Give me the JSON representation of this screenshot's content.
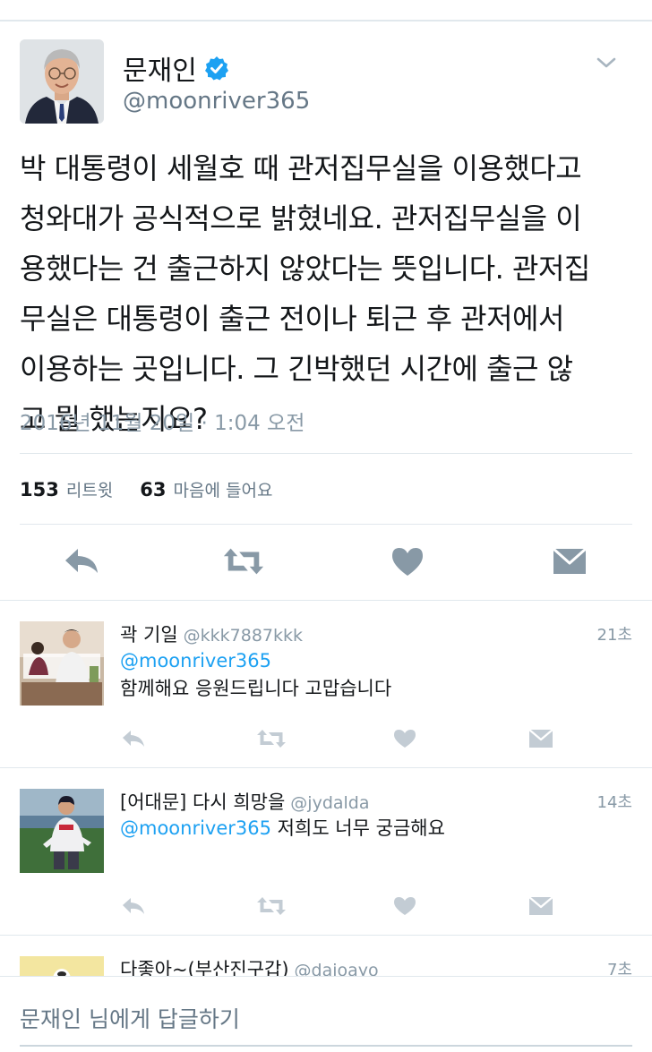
{
  "tweet": {
    "author_name": "문재인",
    "author_handle": "@moonriver365",
    "text_lines": [
      "박 대통령이 세월호 때 관저집무실을 이용했다고",
      "청와대가 공식적으로 밝혔네요. 관저집무실을 이",
      "용했다는 건 출근하지 않았다는 뜻입니다. 관저집",
      "무실은 대통령이 출근 전이나 퇴근 후 관저에서",
      "이용하는 곳입니다. 그 긴박했던 시간에 출근 않",
      "고 뭘 했는지요?"
    ],
    "timestamp": "2016년 11월 20일 · 1:04 오전",
    "retweet_count": "153",
    "retweet_label": "리트윗",
    "like_count": "63",
    "like_label": "마음에 들어요",
    "icons": [
      "reply-icon",
      "retweet-icon",
      "heart-icon",
      "direct-message-icon"
    ]
  },
  "replies": [
    {
      "name": "곽 기일",
      "handle": "@kkk7887kkk",
      "time": "21초",
      "mention": "@moonriver365",
      "text": "함께해요 응원드립니다 고맙습니다"
    },
    {
      "name": "[어대문] 다시 희망을",
      "handle": "@jydalda",
      "time": "14초",
      "mention": "@moonriver365",
      "text": " 저희도 너무 궁금해요"
    },
    {
      "name": "다좋아~(부산진구갑)",
      "handle": "@dajoayo",
      "time": "7초"
    }
  ],
  "composer": {
    "placeholder": "문재인 님에게 답글하기"
  },
  "colors": {
    "accent": "#1da1f2",
    "icon_gray": "#8899a6",
    "text_secondary": "#657786",
    "divider": "#e1e8ed"
  }
}
